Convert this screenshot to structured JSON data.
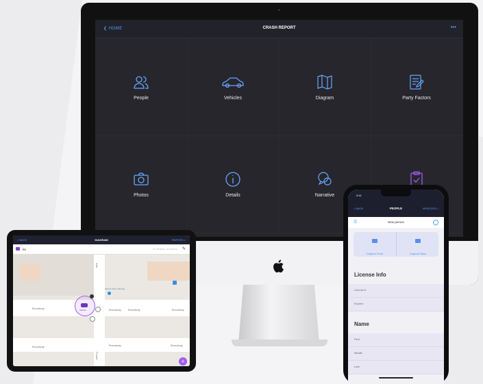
{
  "imac": {
    "back_label": "HOME",
    "title": "CRASH REPORT",
    "more": "•••",
    "accent": "#4da3ff",
    "tiles": [
      {
        "label": "People",
        "icon": "people-icon",
        "color": "#6aa8ff"
      },
      {
        "label": "Vehicles",
        "icon": "car-icon",
        "color": "#6aa8ff"
      },
      {
        "label": "Diagram",
        "icon": "map-icon",
        "color": "#6aa8ff"
      },
      {
        "label": "Party Factors",
        "icon": "form-icon",
        "color": "#6aa8ff"
      },
      {
        "label": "Photos",
        "icon": "camera-icon",
        "color": "#6aa8ff"
      },
      {
        "label": "Details",
        "icon": "info-icon",
        "color": "#6aa8ff"
      },
      {
        "label": "Narrative",
        "icon": "chat-icon",
        "color": "#6aa8ff"
      },
      {
        "label": "",
        "icon": "clipboard-icon",
        "color": "#a25cf0"
      }
    ]
  },
  "ipad": {
    "back": "< BACK",
    "title": "DIAGRAM",
    "right": "PARTIES >",
    "sub_left": "P1",
    "sub_right": "BY TOOFAR · HUT MUCH",
    "streets": {
      "broadway_1": "Broadway",
      "broadway_2": "Broadway",
      "broadway_3": "Broadway",
      "broadway_4": "Broadway",
      "broadway_5": "Broadway",
      "broadway_6": "Broadway",
      "broadway_7": "Broadway",
      "fourth": "Fourth",
      "arte": "Arte"
    },
    "poi": "Historic Pine Catering",
    "vehicle_label": "Vehicle"
  },
  "iphone": {
    "time": "9:41",
    "back": "< BACK",
    "title": "PEOPLE",
    "right": "VEHICLES >",
    "form_title": "New person",
    "capture_front": "Capture Front",
    "capture_back": "Capture Back",
    "license_header": "License Info",
    "license_field": "License #",
    "expires_field": "Expires",
    "name_header": "Name",
    "first_field": "First",
    "middle_field": "Middle",
    "last_field": "Last"
  }
}
